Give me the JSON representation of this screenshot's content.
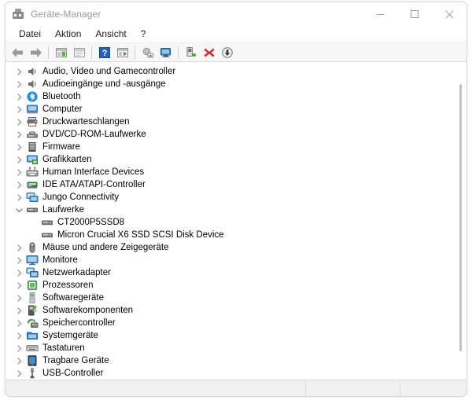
{
  "window": {
    "title": "Geräte-Manager",
    "icon": "device-manager-icon",
    "controls": {
      "minimize": "minimize-button",
      "maximize": "maximize-button",
      "close": "close-button"
    }
  },
  "menu": {
    "items": [
      {
        "label": "Datei"
      },
      {
        "label": "Aktion"
      },
      {
        "label": "Ansicht"
      },
      {
        "label": "?"
      }
    ]
  },
  "toolbar": {
    "buttons": [
      {
        "name": "back-arrow-icon",
        "kind": "back"
      },
      {
        "name": "forward-arrow-icon",
        "kind": "forward"
      },
      {
        "name": "separator-1",
        "kind": "separator"
      },
      {
        "name": "show-hidden-devices-icon",
        "kind": "panel-green"
      },
      {
        "name": "properties-icon",
        "kind": "panel-plain"
      },
      {
        "name": "separator-2",
        "kind": "separator"
      },
      {
        "name": "help-icon",
        "kind": "help"
      },
      {
        "name": "show-console-tree-icon",
        "kind": "panel-green2"
      },
      {
        "name": "separator-3",
        "kind": "separator"
      },
      {
        "name": "update-driver-icon",
        "kind": "gear-green"
      },
      {
        "name": "scan-for-hardware-changes-icon",
        "kind": "monitor-blue"
      },
      {
        "name": "separator-4",
        "kind": "separator"
      },
      {
        "name": "add-legacy-hardware-icon",
        "kind": "device-green"
      },
      {
        "name": "uninstall-device-icon",
        "kind": "red-x"
      },
      {
        "name": "disable-device-icon",
        "kind": "circle-down"
      }
    ]
  },
  "tree": {
    "nodes": [
      {
        "label": "Audio, Video und Gamecontroller",
        "icon": "speaker-icon",
        "state": "collapsed",
        "level": 0
      },
      {
        "label": "Audioeingänge und -ausgänge",
        "icon": "speaker-icon",
        "state": "collapsed",
        "level": 0
      },
      {
        "label": "Bluetooth",
        "icon": "bluetooth-icon",
        "state": "collapsed",
        "level": 0
      },
      {
        "label": "Computer",
        "icon": "computer-icon",
        "state": "collapsed",
        "level": 0
      },
      {
        "label": "Druckwarteschlangen",
        "icon": "printer-icon",
        "state": "collapsed",
        "level": 0
      },
      {
        "label": "DVD/CD-ROM-Laufwerke",
        "icon": "optical-drive-icon",
        "state": "collapsed",
        "level": 0
      },
      {
        "label": "Firmware",
        "icon": "firmware-icon",
        "state": "collapsed",
        "level": 0
      },
      {
        "label": "Grafikkarten",
        "icon": "display-adapter-icon",
        "state": "collapsed",
        "level": 0
      },
      {
        "label": "Human Interface Devices",
        "icon": "hid-icon",
        "state": "collapsed",
        "level": 0
      },
      {
        "label": "IDE ATA/ATAPI-Controller",
        "icon": "ide-controller-icon",
        "state": "collapsed",
        "level": 0
      },
      {
        "label": "Jungo Connectivity",
        "icon": "network-device-icon",
        "state": "collapsed",
        "level": 0
      },
      {
        "label": "Laufwerke",
        "icon": "disk-drive-icon",
        "state": "expanded",
        "level": 0
      },
      {
        "label": "CT2000P5SSD8",
        "icon": "disk-drive-icon",
        "state": "leaf",
        "level": 1
      },
      {
        "label": "Micron Crucial X6 SSD SCSI Disk Device",
        "icon": "disk-drive-icon",
        "state": "leaf",
        "level": 1
      },
      {
        "label": "Mäuse und andere Zeigegeräte",
        "icon": "mouse-icon",
        "state": "collapsed",
        "level": 0
      },
      {
        "label": "Monitore",
        "icon": "monitor-icon",
        "state": "collapsed",
        "level": 0
      },
      {
        "label": "Netzwerkadapter",
        "icon": "network-adapter-icon",
        "state": "collapsed",
        "level": 0
      },
      {
        "label": "Prozessoren",
        "icon": "processor-icon",
        "state": "collapsed",
        "level": 0
      },
      {
        "label": "Softwaregeräte",
        "icon": "software-device-icon",
        "state": "collapsed",
        "level": 0
      },
      {
        "label": "Softwarekomponenten",
        "icon": "software-component-icon",
        "state": "collapsed",
        "level": 0
      },
      {
        "label": "Speichercontroller",
        "icon": "storage-controller-icon",
        "state": "collapsed",
        "level": 0
      },
      {
        "label": "Systemgeräte",
        "icon": "system-device-icon",
        "state": "collapsed",
        "level": 0
      },
      {
        "label": "Tastaturen",
        "icon": "keyboard-icon",
        "state": "collapsed",
        "level": 0
      },
      {
        "label": "Tragbare Geräte",
        "icon": "portable-device-icon",
        "state": "collapsed",
        "level": 0
      },
      {
        "label": "USB-Controller",
        "icon": "usb-icon",
        "state": "collapsed",
        "level": 0
      }
    ]
  },
  "statusbar": {
    "main": "",
    "pane2": "",
    "pane3": ""
  },
  "colors": {
    "accent_blue": "#2f6fd0",
    "bluetooth_blue": "#1b8ef2",
    "green": "#3c9e2e",
    "red": "#d7261f",
    "chevron_gray": "#8b8b8b",
    "icon_gray": "#6e6e6e"
  }
}
